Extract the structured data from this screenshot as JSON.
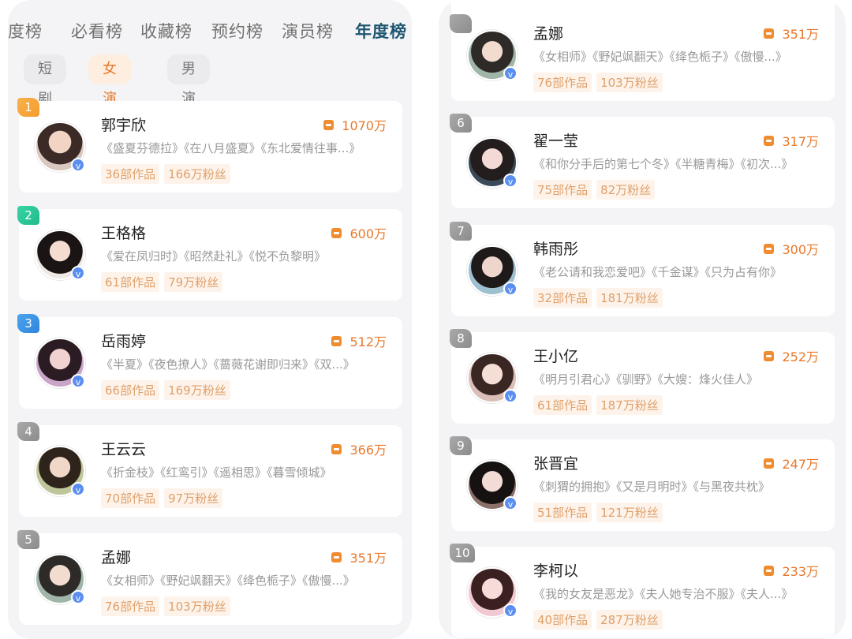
{
  "tabs": [
    "度榜",
    "必看榜",
    "收藏榜",
    "预约榜",
    "演员榜",
    "年度榜"
  ],
  "chips": [
    "短剧",
    "女演员",
    "男演员"
  ],
  "cards": [
    {
      "rank": "1",
      "name": "郭宇欣",
      "heat": "1070万",
      "works": "《盛夏芬德拉》《在八月盛夏》《东北爱情往事...》",
      "count": "36部作品",
      "fans": "166万粉丝"
    },
    {
      "rank": "2",
      "name": "王格格",
      "heat": "600万",
      "works": "《爱在凤归时》《昭然赴礼》《悦不负黎明》",
      "count": "61部作品",
      "fans": "79万粉丝"
    },
    {
      "rank": "3",
      "name": "岳雨婷",
      "heat": "512万",
      "works": "《半夏》《夜色撩人》《蔷薇花谢即归来》《双...》",
      "count": "66部作品",
      "fans": "169万粉丝"
    },
    {
      "rank": "4",
      "name": "王云云",
      "heat": "366万",
      "works": "《折金枝》《红鸾引》《遥相思》《暮雪倾城》",
      "count": "70部作品",
      "fans": "97万粉丝"
    },
    {
      "rank": "5",
      "name": "孟娜",
      "heat": "351万",
      "works": "《女相师》《野妃飒翻天》《绛色栀子》《傲慢...》",
      "count": "76部作品",
      "fans": "103万粉丝"
    },
    {
      "rank": "6",
      "name": "翟一莹",
      "heat": "317万",
      "works": "《和你分手后的第七个冬》《半糖青梅》《初次...》",
      "count": "75部作品",
      "fans": "82万粉丝"
    },
    {
      "rank": "7",
      "name": "韩雨彤",
      "heat": "300万",
      "works": "《老公请和我恋爱吧》《千金谋》《只为占有你》",
      "count": "32部作品",
      "fans": "181万粉丝"
    },
    {
      "rank": "8",
      "name": "王小亿",
      "heat": "252万",
      "works": "《明月引君心》《驯野》《大嫂：烽火佳人》",
      "count": "61部作品",
      "fans": "187万粉丝"
    },
    {
      "rank": "9",
      "name": "张晋宜",
      "heat": "247万",
      "works": "《刺猬的拥抱》《又是月明时》《与黑夜共枕》",
      "count": "51部作品",
      "fans": "121万粉丝"
    },
    {
      "rank": "10",
      "name": "李柯以",
      "heat": "233万",
      "works": "《我的女友是恶龙》《夫人她专治不服》《夫人...》",
      "count": "40部作品",
      "fans": "287万粉丝"
    }
  ],
  "icons": {
    "heat": "heat-icon",
    "verified": "verified-badge-icon"
  },
  "colors": {
    "accent": "#e8782a",
    "rank1": "#f39c2f",
    "rank2": "#22b98b",
    "rank3": "#2f86dc",
    "rank_other": "#8c8c8c",
    "verified": "#5a8ef0"
  }
}
